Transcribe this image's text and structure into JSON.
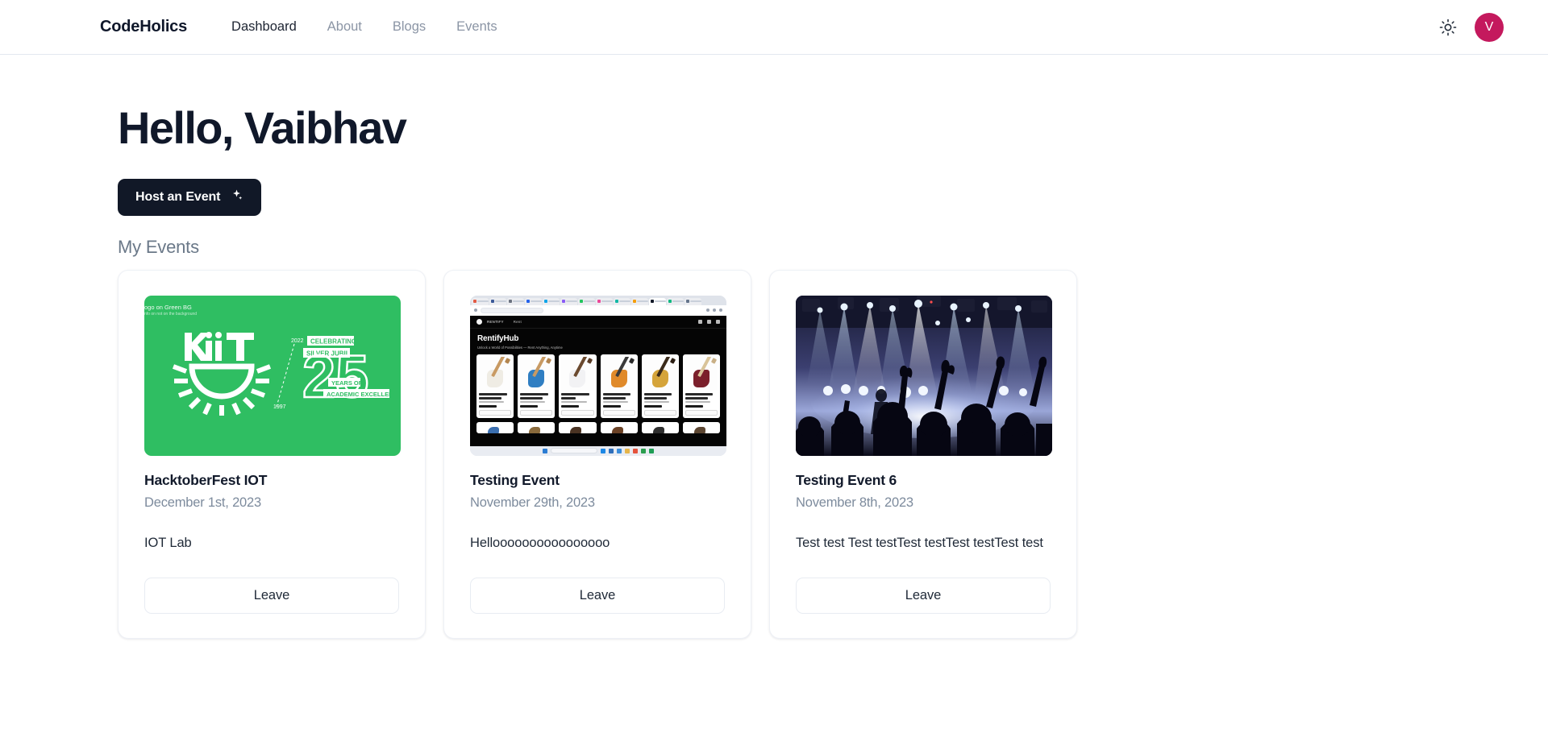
{
  "header": {
    "brand": "CodeHolics",
    "nav": [
      {
        "label": "Dashboard",
        "active": true
      },
      {
        "label": "About",
        "active": false
      },
      {
        "label": "Blogs",
        "active": false
      },
      {
        "label": "Events",
        "active": false
      }
    ],
    "theme_toggle_icon": "sun-icon",
    "avatar_initial": "V",
    "avatar_color": "#c4195d"
  },
  "main": {
    "greeting": "Hello, Vaibhav",
    "host_button_label": "Host an Event",
    "host_button_icon": "sparkles-icon",
    "section_title": "My Events"
  },
  "events": [
    {
      "title": "HacktoberFest IOT",
      "date": "December 1st, 2023",
      "description": "IOT Lab",
      "action_label": "Leave",
      "image": {
        "kind": "kiit-poster",
        "background": "#2fbe62",
        "note_line1": "ogo on Green BG",
        "note_line2": "nfo on not on the background",
        "logo_text": "KiiT",
        "year_from": "1997",
        "year_to": "2022",
        "celebrating": "CELEBRATING",
        "jubilee": "SILVER JUBILEE",
        "number": "25",
        "years_of": "YEARS OF",
        "excellence": "ACADEMIC EXCELLENCE"
      }
    },
    {
      "title": "Testing Event",
      "date": "November 29th, 2023",
      "description": "Helloooooooooooooooo",
      "action_label": "Leave",
      "image": {
        "kind": "browser-screenshot",
        "site_name": "RentifyHub",
        "site_tagline": "Unlock a World of Possibilities — Rent Anything, Anytime",
        "nav_brand": "RENTIFY",
        "nav_link": "Rent",
        "products": [
          {
            "name": "Fender Player Stratocaster HSS",
            "color": "#efece4"
          },
          {
            "name": "Squier Bullet Stratocaster",
            "color": "#2f7ec2"
          },
          {
            "name": "Ibanez AZ2402",
            "color": "#f2f2f4"
          },
          {
            "name": "Yamaha Pacifica 112VM",
            "color": "#e08a2a"
          },
          {
            "name": "Gibson Custom Historic '57 Les Paul",
            "color": "#d5a43a"
          },
          {
            "name": "Fender American Performer Telecaster",
            "color": "#7b1f2b"
          }
        ],
        "product_button_label": "Rent Now"
      }
    },
    {
      "title": "Testing Event 6",
      "date": "November 8th, 2023",
      "description": "Test test Test testTest testTest testTest test",
      "action_label": "Leave",
      "image": {
        "kind": "concert-photo",
        "alt": "Concert crowd with raised hands under blue stage lights"
      }
    }
  ]
}
